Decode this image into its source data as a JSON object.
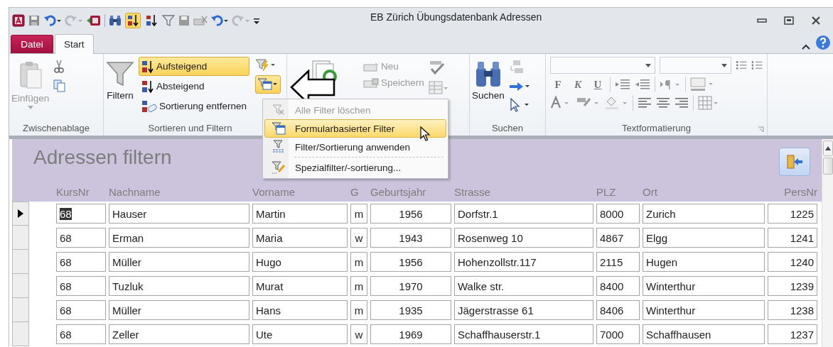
{
  "window": {
    "title": "EB Zürich Übungsdatenbank Adressen"
  },
  "tabs": [
    {
      "label": "Datei",
      "kind": "file",
      "selected": false
    },
    {
      "label": "Start",
      "kind": "tab",
      "selected": true
    }
  ],
  "ribbon": {
    "clipboard": {
      "paste": "Einfügen",
      "label": "Zwischenablage"
    },
    "sort_filter": {
      "filter": "Filtern",
      "label": "Sortieren und Filtern",
      "sort_buttons": [
        {
          "label": "Aufsteigend",
          "selected": true
        },
        {
          "label": "Absteigend",
          "selected": false
        },
        {
          "label": "Sortierung entfernen",
          "selected": false
        }
      ],
      "advanced_button_active": true
    },
    "records": {
      "new": "Neu",
      "save": "Speichern"
    },
    "find": {
      "label": "Suchen",
      "find": "Suchen"
    },
    "text_formatting": {
      "label": "Textformatierung",
      "format_buttons": [
        "F",
        "K",
        "U"
      ]
    }
  },
  "filter_menu": [
    {
      "label": "Alle Filter löschen",
      "disabled": true,
      "selected": false,
      "separator": false
    },
    {
      "label": "Formularbasierter Filter",
      "disabled": false,
      "selected": true,
      "separator": false
    },
    {
      "label": "Filter/Sortierung anwenden",
      "disabled": false,
      "selected": false,
      "separator": false
    },
    {
      "label": "Spezialfilter/-sortierung...",
      "disabled": false,
      "selected": false,
      "separator": true
    }
  ],
  "form": {
    "title": "Adressen filtern",
    "columns": [
      "KursNr",
      "Nachname",
      "Vorname",
      "G",
      "Geburtsjahr",
      "Strasse",
      "PLZ",
      "Ort",
      "PersNr"
    ],
    "rows": [
      {
        "current": true,
        "cells": [
          "68",
          "Hauser",
          "Martin",
          "m",
          "1956",
          "Dorfstr.1",
          "8000",
          "Zurich",
          "1225"
        ]
      },
      {
        "current": false,
        "cells": [
          "68",
          "Erman",
          "Maria",
          "w",
          "1943",
          "Rosenweg 10",
          "4867",
          "Elgg",
          "1241"
        ]
      },
      {
        "current": false,
        "cells": [
          "68",
          "Müller",
          "Hugo",
          "m",
          "1956",
          "Hohenzollstr.117",
          "2115",
          "Hugen",
          "1240"
        ]
      },
      {
        "current": false,
        "cells": [
          "68",
          "Tuzluk",
          "Murat",
          "m",
          "1970",
          "Walke str.",
          "8400",
          "Winterthur",
          "1239"
        ]
      },
      {
        "current": false,
        "cells": [
          "68",
          "Müller",
          "Hans",
          "m",
          "1935",
          "Jägerstrasse 61",
          "8406",
          "Winterthur",
          "1238"
        ]
      },
      {
        "current": false,
        "cells": [
          "68",
          "Zeller",
          "Ute",
          "w",
          "1969",
          "Schaffhauserstr.1",
          "7000",
          "Schaffhausen",
          "1237"
        ]
      }
    ]
  }
}
